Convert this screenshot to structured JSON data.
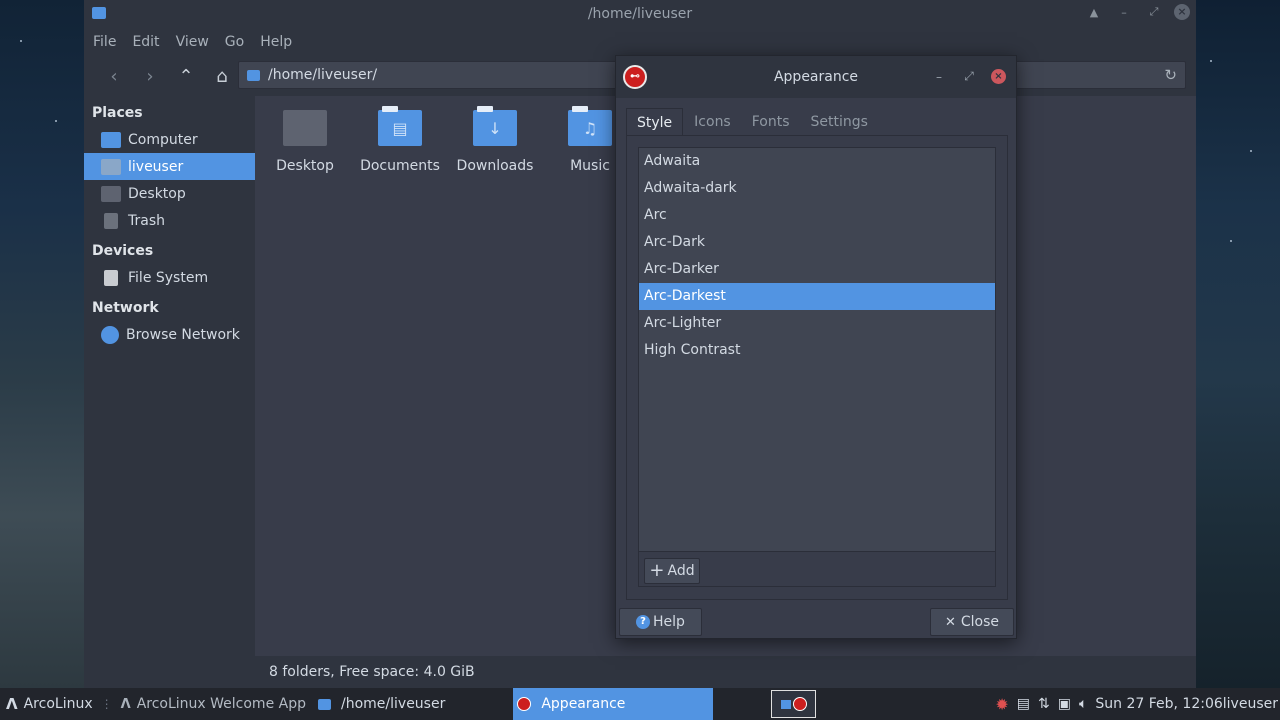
{
  "file_manager": {
    "title": "/home/liveuser",
    "menu": [
      "File",
      "Edit",
      "View",
      "Go",
      "Help"
    ],
    "address": "/home/liveuser/",
    "sidebar": {
      "places_header": "Places",
      "places": [
        "Computer",
        "liveuser",
        "Desktop",
        "Trash"
      ],
      "devices_header": "Devices",
      "devices": [
        "File System"
      ],
      "network_header": "Network",
      "network": [
        "Browse Network"
      ]
    },
    "folders": [
      "Desktop",
      "Documents",
      "Downloads",
      "Music"
    ],
    "status": "8 folders, Free space: 4.0 GiB"
  },
  "dialog": {
    "title": "Appearance",
    "tabs": [
      "Style",
      "Icons",
      "Fonts",
      "Settings"
    ],
    "themes": [
      "Adwaita",
      "Adwaita-dark",
      "Arc",
      "Arc-Dark",
      "Arc-Darker",
      "Arc-Darkest",
      "Arc-Lighter",
      "High Contrast"
    ],
    "selected_theme": "Arc-Darkest",
    "add_label": "Add",
    "help_label": "Help",
    "close_label": "Close"
  },
  "taskbar": {
    "start": "ArcoLinux",
    "welcome": "ArcoLinux Welcome App",
    "files": "/home/liveuser",
    "appearance": "Appearance",
    "clock": "Sun 27 Feb, 12:06",
    "user": "liveuser"
  },
  "colors": {
    "accent": "#5294e2",
    "base": "#383c4a",
    "header": "#2f343f"
  }
}
